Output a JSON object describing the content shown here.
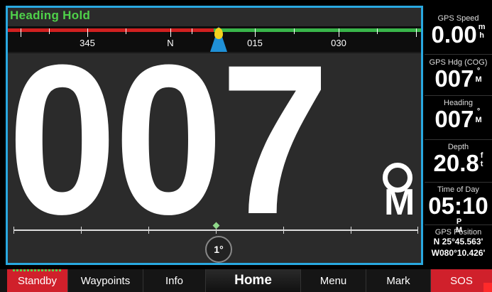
{
  "autopilot": {
    "mode": "Heading Hold",
    "heading_value": "007",
    "heading_unit_symbol": "°",
    "heading_unit_letter": "M",
    "compass_labels": [
      "345",
      "N",
      "015",
      "030"
    ],
    "rudder_gain": "1°"
  },
  "data_fields": [
    {
      "label": "GPS Speed",
      "value": "0.00",
      "unit_top": "m",
      "unit_bottom": "h"
    },
    {
      "label": "GPS Hdg (COG)",
      "value": "007",
      "unit_top": "°",
      "unit_bottom": "M"
    },
    {
      "label": "Heading",
      "value": "007",
      "unit_top": "°",
      "unit_bottom": "M"
    },
    {
      "label": "Depth",
      "value": "20.8",
      "unit_top": "f",
      "unit_bottom": "t"
    },
    {
      "label": "Time of Day",
      "value": "05:10",
      "unit_top": "P",
      "unit_bottom": "M"
    }
  ],
  "gps_position": {
    "label": "GPS Position",
    "lat": "N  25°45.563'",
    "lon": "W080°10.426'"
  },
  "nav": {
    "standby": "Standby",
    "waypoints": "Waypoints",
    "info": "Info",
    "home": "Home",
    "menu": "Menu",
    "mark": "Mark",
    "sos": "SOS"
  },
  "colors": {
    "accent_border": "#29a8e0",
    "mode_text": "#4fd14a",
    "alert_red": "#d0202b"
  }
}
